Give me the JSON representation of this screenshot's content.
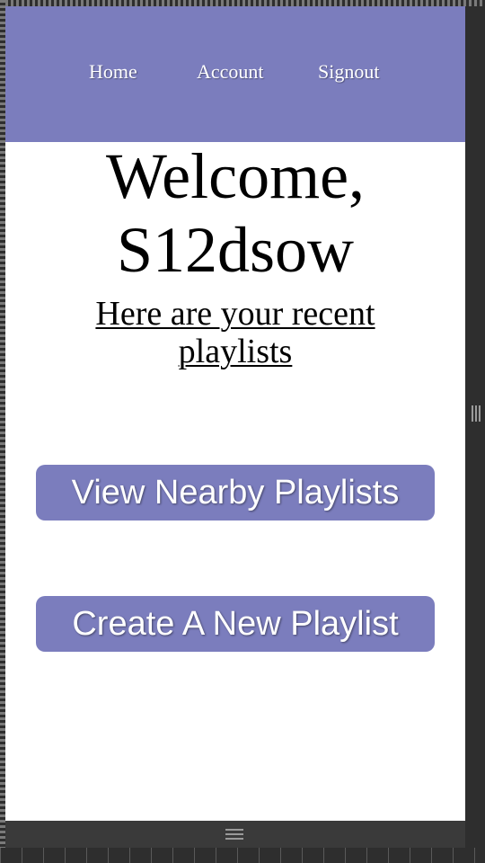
{
  "nav": {
    "home": "Home",
    "account": "Account",
    "signout": "Signout"
  },
  "main": {
    "welcome_line1": "Welcome,",
    "welcome_line2": "S12dsow",
    "subtitle": "Here are your recent playlists"
  },
  "actions": {
    "nearby_label": "View Nearby Playlists",
    "create_label": "Create A New Playlist"
  },
  "colors": {
    "accent": "#7b7dbd",
    "frame": "#2e2e2e"
  }
}
